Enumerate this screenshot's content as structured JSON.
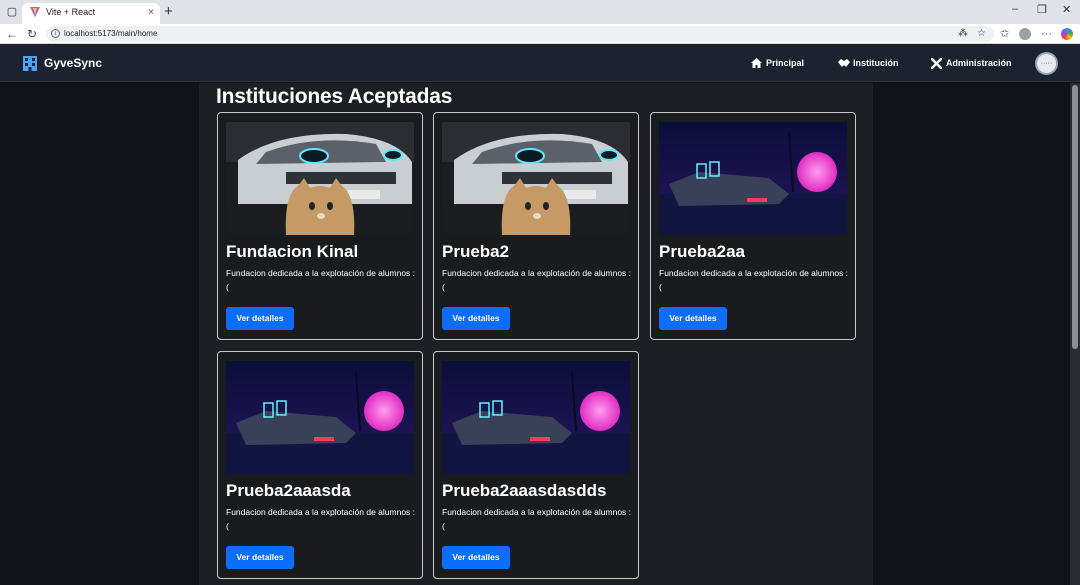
{
  "browser": {
    "tab_title": "Vite + React",
    "tab_close": "×",
    "new_tab": "+",
    "url": "localhost:5173/main/home"
  },
  "app": {
    "brand": "GyveSync",
    "nav": [
      {
        "label": "Principal",
        "icon": "home-icon"
      },
      {
        "label": "Institución",
        "icon": "handshake-icon"
      },
      {
        "label": "Administración",
        "icon": "tools-icon"
      }
    ],
    "avatar_text": "·····"
  },
  "page": {
    "title": "Instituciones Aceptadas"
  },
  "cards": [
    {
      "title": "Fundacion Kinal",
      "description": "Fundacion dedicada a la explotación de alumnos :(",
      "button": "Ver detalles",
      "image": "car-cat-photo"
    },
    {
      "title": "Prueba2",
      "description": "Fundacion dedicada a la explotación de alumnos :(",
      "button": "Ver detalles",
      "image": "car-cat-photo"
    },
    {
      "title": "Prueba2aa",
      "description": "Fundacion dedicada a la explotación de alumnos :(",
      "button": "Ver detalles",
      "image": "synthwave-car-image"
    },
    {
      "title": "Prueba2aaasda",
      "description": "Fundacion dedicada a la explotación de alumnos :(",
      "button": "Ver detalles",
      "image": "synthwave-car-image"
    },
    {
      "title": "Prueba2aaasdasdds",
      "description": "Fundacion dedicada a la explotación de alumnos :(",
      "button": "Ver detalles",
      "image": "synthwave-car-image"
    }
  ],
  "colors": {
    "accent": "#0d6efd",
    "navbar": "#1c2230",
    "content_bg": "#1d1f24"
  }
}
